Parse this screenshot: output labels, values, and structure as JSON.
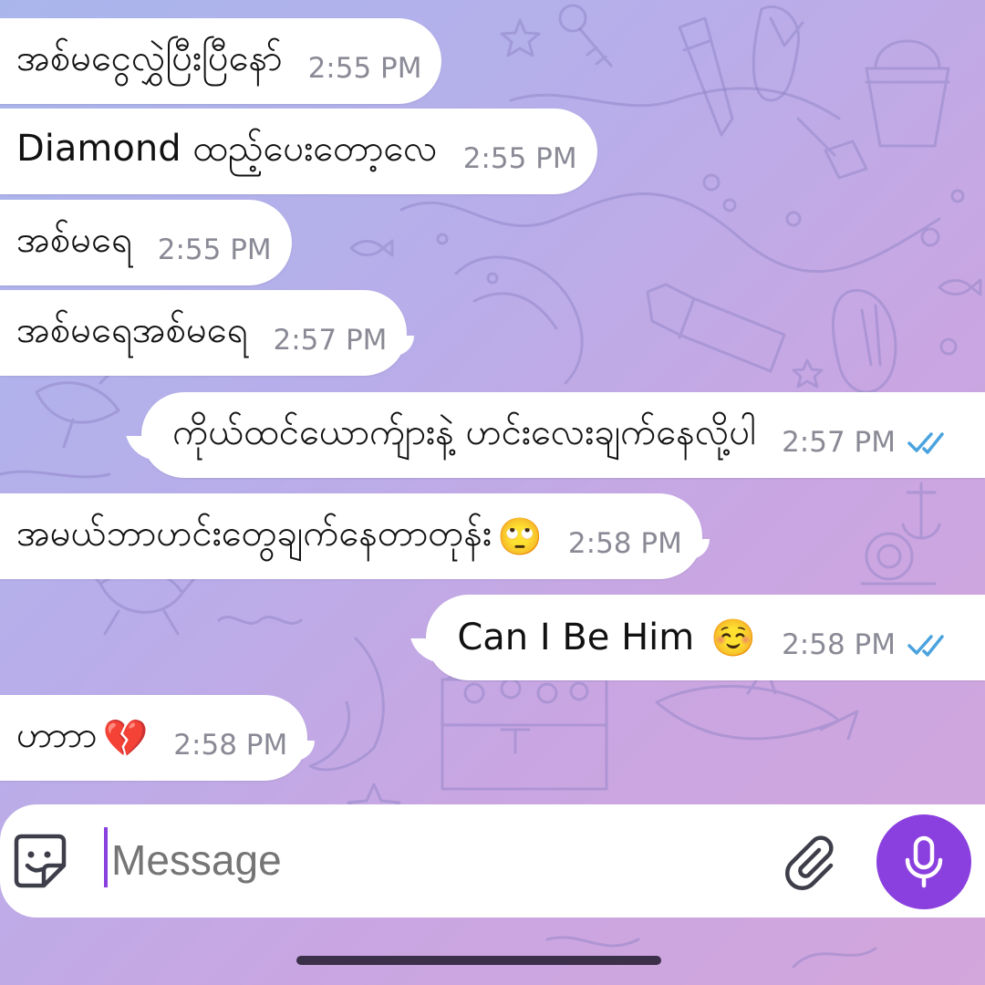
{
  "colors": {
    "background_start": "#a9b6ec",
    "background_end": "#d3a6dc",
    "bubble": "#ffffff",
    "time": "#8a8a96",
    "read_checks": "#4aa3df",
    "mic_button": "#8a3fdf"
  },
  "messages": [
    {
      "direction": "in",
      "text": "အစ်မငွေလွှဲပြီးပြီနော်",
      "time": "2:55 PM"
    },
    {
      "direction": "in",
      "text": "Diamond ထည့်ပေးတော့လေ",
      "time": "2:55 PM"
    },
    {
      "direction": "in",
      "text": "အစ်မရေ",
      "time": "2:55 PM"
    },
    {
      "direction": "in",
      "text": "အစ်မရေအစ်မရေ",
      "time": "2:57 PM"
    },
    {
      "direction": "out",
      "text": "ကိုယ်ထင်ယောက်ျားနဲ့ ဟင်းလေးချက်နေလို့ပါ",
      "time": "2:57 PM",
      "status": "read"
    },
    {
      "direction": "in",
      "text": "အမယ်ဘာဟင်းတွေချက်နေတာတုန်း",
      "emoji": "🙄",
      "time": "2:58 PM"
    },
    {
      "direction": "out",
      "text": "Can I Be Him",
      "emoji": "☺️",
      "time": "2:58 PM",
      "status": "read"
    },
    {
      "direction": "in",
      "text": "ဟာာာ",
      "emoji": "💔",
      "time": "2:58 PM"
    }
  ],
  "composer": {
    "placeholder": "Message",
    "sticker_icon": "sticker-smile-icon",
    "attach_icon": "paperclip-icon",
    "mic_icon": "microphone-icon"
  }
}
